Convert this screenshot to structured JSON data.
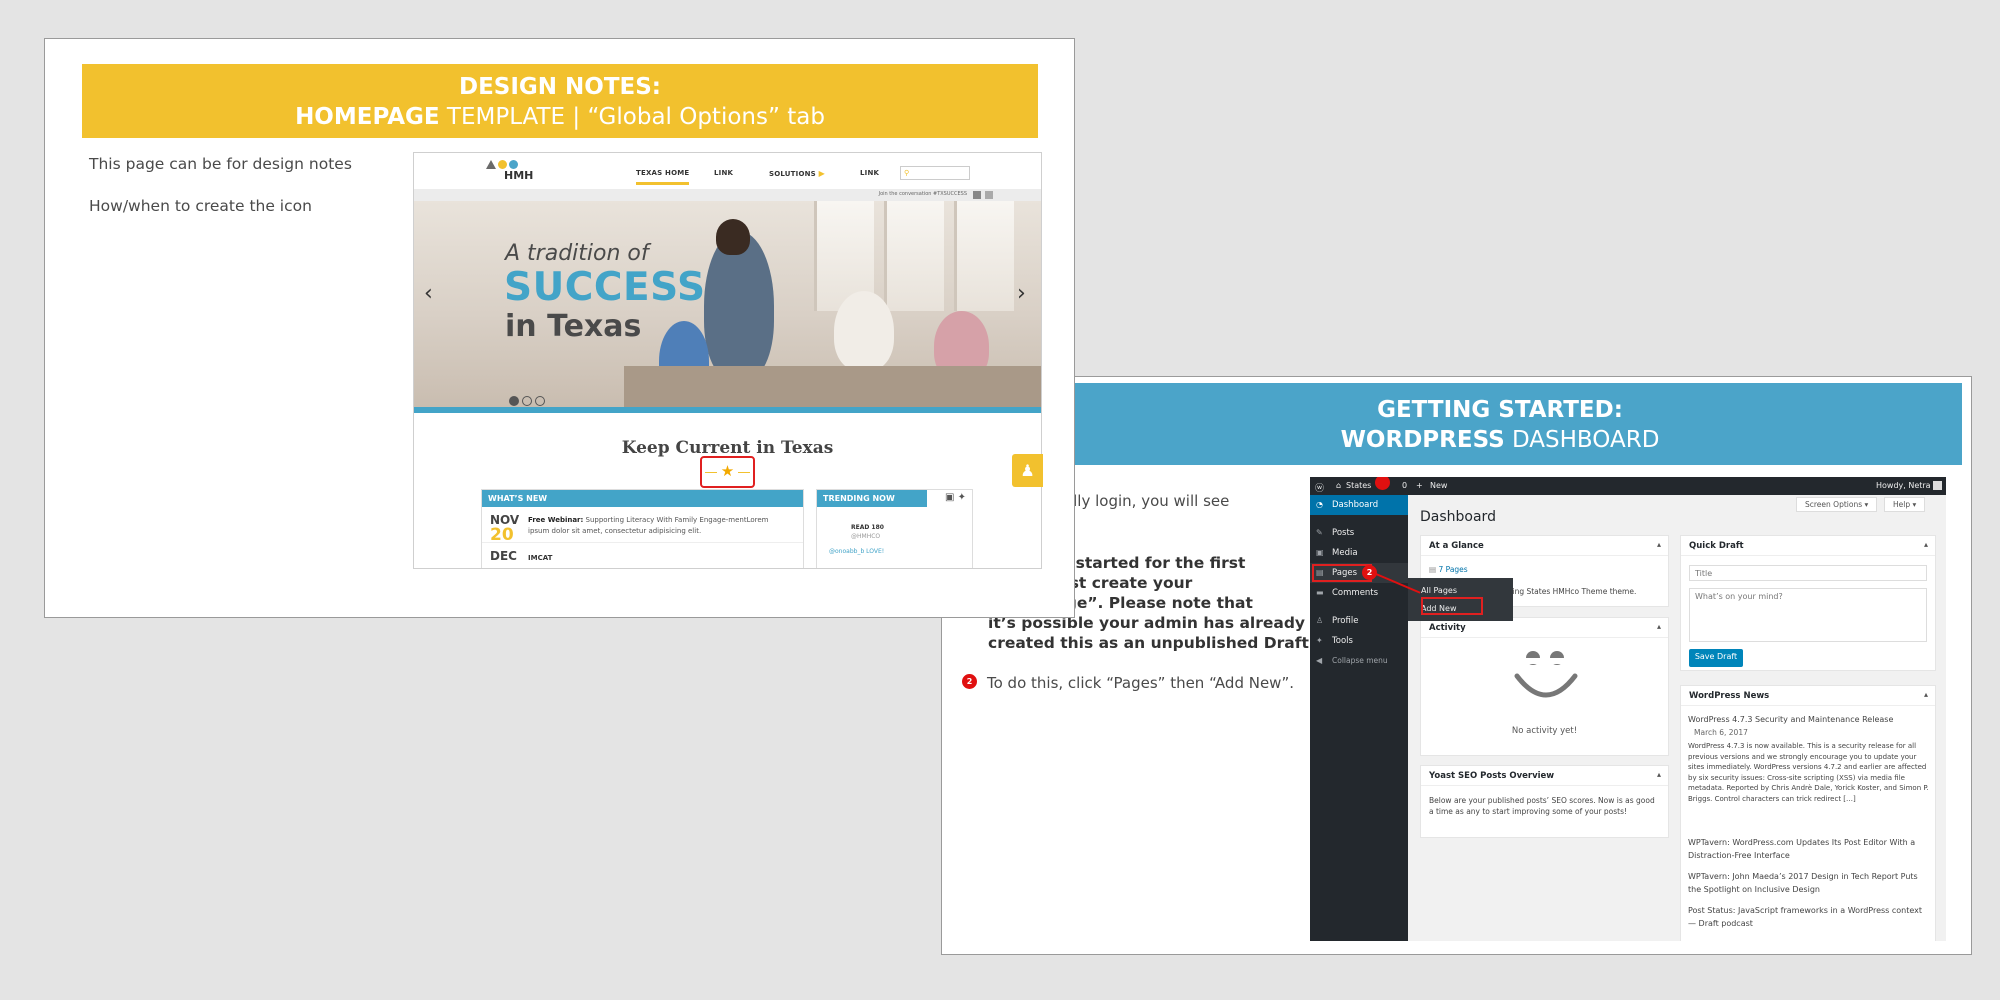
{
  "slide1": {
    "banner_line1": "DESIGN NOTES:",
    "banner_line2_bold": "HOMEPAGE",
    "banner_line2_rest": " TEMPLATE  |  “Global Options” tab",
    "note1": "This page can be for design notes",
    "note2": "How/when to create the icon",
    "homepage": {
      "logo": "HMH",
      "nav": [
        "TEXAS HOME",
        "LINK",
        "SOLUTIONS",
        "LINK"
      ],
      "search_icon": "search-icon",
      "social_text": "Join the conversation #TXSUCCESS",
      "hero_line1": "A tradition of",
      "hero_line2": "SUCCESS",
      "hero_line3": "in Texas",
      "keep_current": "Keep Current in Texas",
      "whats_new_label": "WHAT’S NEW",
      "item1_month": "NOV",
      "item1_day": "20",
      "item1_title": "Free Webinar:",
      "item1_text": " Supporting Literacy With Family Engage-mentLorem ipsum dolor sit amet, consectetur adipisicing elit.",
      "item2_month": "DEC",
      "item2_text": "IMCAT",
      "trending_label": "TRENDING NOW",
      "tweet1": "READ 180",
      "tweet2": "@HMHCO",
      "tweet3": "@onoabb_b LOVE!",
      "accent_yellow": "#f2c12e",
      "accent_blue": "#43a4c8"
    }
  },
  "slide2": {
    "banner_line1": "GETTING STARTED:",
    "banner_line2_bold": "WORDPRESS",
    "banner_line2_rest": " DASHBOARD",
    "para1": "…ccessfully login, you will see",
    "para2_l1": "…etting started for the first",
    "para2_l2": "…ust first create your",
    "para2_l3": "…mepage”. Please note that",
    "para2_l4": "it’s possible your admin has already",
    "para2_l5": "created this as an unpublished Draft.",
    "step2_marker": "2",
    "step2_text": "To do this, click “Pages” then “Add New”.",
    "wp": {
      "site": "States",
      "comments_count": "0",
      "new_label": "New",
      "howdy": "Howdy, Netra",
      "menu": [
        "Dashboard",
        "Posts",
        "Media",
        "Pages",
        "Comments",
        "Profile",
        "Tools",
        "Collapse menu"
      ],
      "flyout": [
        "All Pages",
        "Add New"
      ],
      "page_title": "Dashboard",
      "screen_options": "Screen Options ▾",
      "help": "Help ▾",
      "at_glance_title": "At a Glance",
      "at_glance_pages": "7 Pages",
      "at_glance_theme": "…ing States HMHco Theme theme.",
      "activity_title": "Activity",
      "activity_empty": "No activity yet!",
      "yoast_title": "Yoast SEO Posts Overview",
      "yoast_text": "Below are your published posts’ SEO scores. Now is as good a time as any to start improving some of your posts!",
      "quick_draft_title": "Quick Draft",
      "qd_title_placeholder": "Title",
      "qd_body_placeholder": "What’s on your mind?",
      "save_draft": "Save Draft",
      "news_title": "WordPress News",
      "news1": "WordPress 4.7.3 Security and Maintenance Release",
      "news1_date": "March 6, 2017",
      "news1_body": "WordPress 4.7.3 is now available. This is a security release for all previous versions and we strongly encourage you to update your sites immediately. WordPress versions 4.7.2 and earlier are affected by six security issues: Cross-site scripting (XSS) via media file metadata.  Reported by Chris Andrè Dale, Yorick Koster, and Simon P. Briggs. Control characters can trick redirect […]",
      "news2": "WPTavern: WordPress.com Updates Its Post Editor With a Distraction-Free Interface",
      "news3": "WPTavern: John Maeda’s 2017 Design in Tech Report Puts the Spotlight on Inclusive Design",
      "news4": "Post Status: JavaScript frameworks in a WordPress context — Draft podcast",
      "pages_marker": "2",
      "accent_blue": "#0073aa"
    }
  }
}
